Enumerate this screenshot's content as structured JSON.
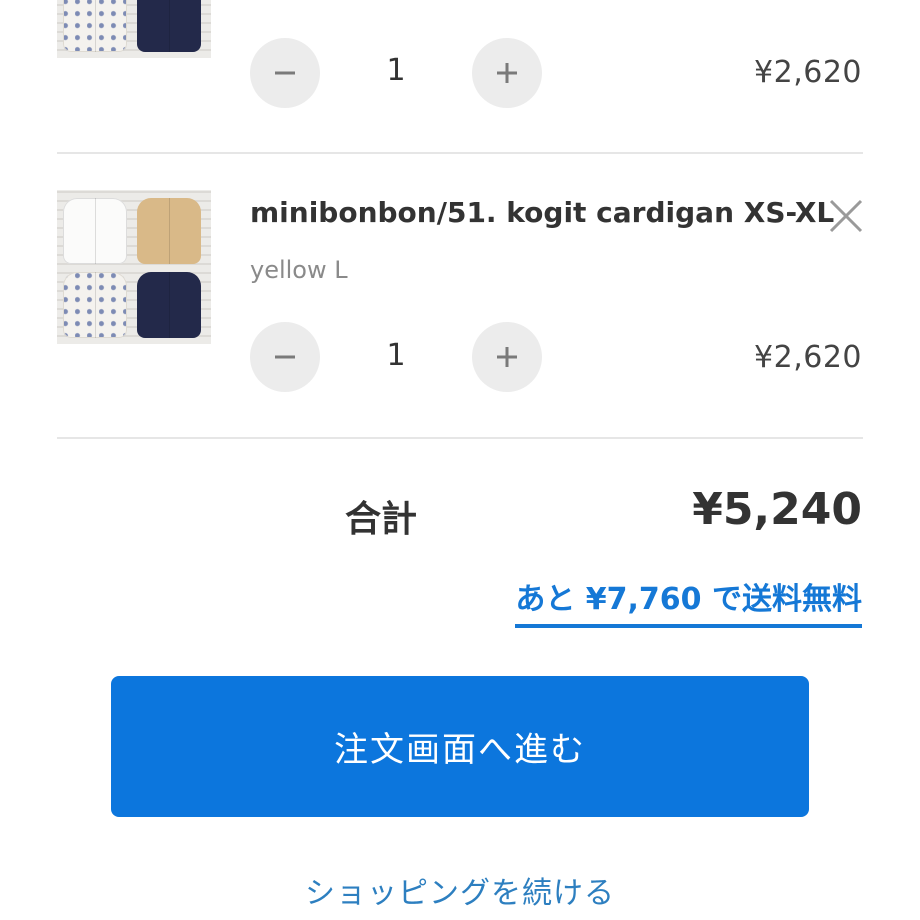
{
  "cart": {
    "items": [
      {
        "quantity": "1",
        "price": "¥2,620"
      },
      {
        "title": "minibonbon/51. kogit cardigan XS-XL",
        "variant": "yellow L",
        "quantity": "1",
        "price": "¥2,620"
      }
    ]
  },
  "summary": {
    "total_label": "合計",
    "total_value": "¥5,240",
    "free_shipping_text": "あと ¥7,760 で送料無料"
  },
  "actions": {
    "checkout_label": "注文画面へ進む",
    "continue_label": "ショッピングを続ける"
  },
  "colors": {
    "accent": "#0c76dd",
    "link": "#1578d6",
    "qty_button_bg": "#ececec"
  },
  "icons": {
    "decrement": "minus-icon",
    "increment": "plus-icon",
    "remove": "close-icon"
  }
}
